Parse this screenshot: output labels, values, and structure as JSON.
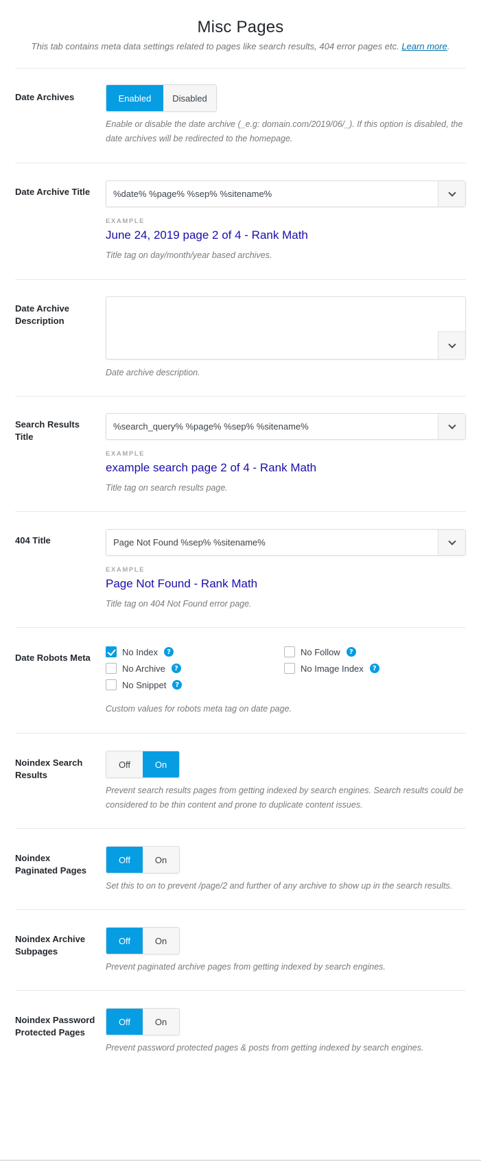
{
  "header": {
    "title": "Misc Pages",
    "description": "This tab contains meta data settings related to pages like search results, 404 error pages etc.",
    "learn_more": "Learn more",
    "period": "."
  },
  "colors": {
    "accent": "#069de3",
    "example_link": "#1a0dab",
    "learn_more_link": "#0073aa"
  },
  "date_archives": {
    "label": "Date Archives",
    "options": [
      "Enabled",
      "Disabled"
    ],
    "selected": "Enabled",
    "description": "Enable or disable the date archive (_e.g: domain.com/2019/06/_). If this option is disabled, the date archives will be redirected to the homepage."
  },
  "date_archive_title": {
    "label": "Date Archive Title",
    "value": "%date% %page% %sep% %sitename%",
    "example_label": "EXAMPLE",
    "example": "June 24, 2019 page 2 of 4 - Rank Math",
    "description": "Title tag on day/month/year based archives."
  },
  "date_archive_description": {
    "label": "Date Archive Description",
    "value": "",
    "description": "Date archive description."
  },
  "search_results_title": {
    "label": "Search Results Title",
    "value": "%search_query% %page% %sep% %sitename%",
    "example_label": "EXAMPLE",
    "example": "example search page 2 of 4 - Rank Math",
    "description": "Title tag on search results page."
  },
  "title_404": {
    "label": "404 Title",
    "value": "Page Not Found %sep% %sitename%",
    "example_label": "EXAMPLE",
    "example": "Page Not Found - Rank Math",
    "description": "Title tag on 404 Not Found error page."
  },
  "date_robots_meta": {
    "label": "Date Robots Meta",
    "options": [
      {
        "label": "No Index",
        "checked": true
      },
      {
        "label": "No Follow",
        "checked": false
      },
      {
        "label": "No Archive",
        "checked": false
      },
      {
        "label": "No Image Index",
        "checked": false
      },
      {
        "label": "No Snippet",
        "checked": false
      }
    ],
    "help_icon": "?",
    "description": "Custom values for robots meta tag on date page."
  },
  "noindex_search_results": {
    "label": "Noindex Search Results",
    "options": [
      "Off",
      "On"
    ],
    "selected": "On",
    "description": "Prevent search results pages from getting indexed by search engines. Search results could be considered to be thin content and prone to duplicate content issues."
  },
  "noindex_paginated_pages": {
    "label": "Noindex Paginated Pages",
    "options": [
      "Off",
      "On"
    ],
    "selected": "Off",
    "description": "Set this to on to prevent /page/2 and further of any archive to show up in the search results."
  },
  "noindex_archive_subpages": {
    "label": "Noindex Archive Subpages",
    "options": [
      "Off",
      "On"
    ],
    "selected": "Off",
    "description": "Prevent paginated archive pages from getting indexed by search engines."
  },
  "noindex_password_protected": {
    "label": "Noindex Password Protected Pages",
    "options": [
      "Off",
      "On"
    ],
    "selected": "Off",
    "description": "Prevent password protected pages & posts from getting indexed by search engines."
  }
}
